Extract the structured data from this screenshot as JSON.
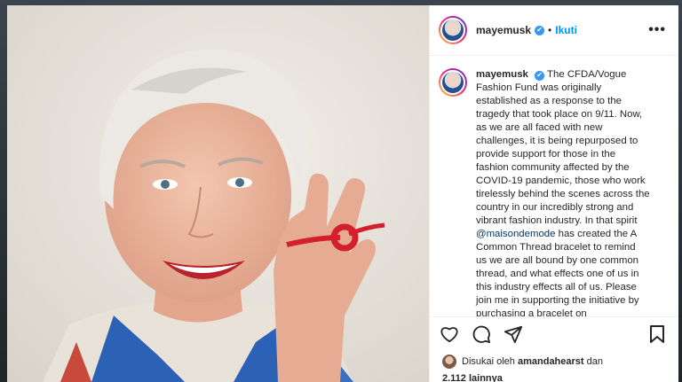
{
  "post": {
    "username": "mayemusk",
    "separator": "•",
    "follow_label": "Ikuti",
    "more_label": "•••",
    "verified_mark": "✔",
    "caption_lines": [
      "The CFDA/Vogue",
      "Fashion Fund was originally",
      "established as a response to the",
      "tragedy that took place on 9/11. Now,",
      "as we are all faced with new",
      "challenges, it is being repurposed to",
      "provide support for those in the",
      "fashion community affected by the",
      "COVID-19 pandemic, those who work",
      "tirelessly behind the scenes across the",
      "country in our incredibly strong and",
      "vibrant fashion industry. In that spirit"
    ],
    "mention": "@maisondemode",
    "caption_after_mention": " has created the A",
    "caption_tail_lines": [
      "Common Thread bracelet to remind",
      "us we are all bound by one common",
      "thread, and what effects one of us in",
      "this industry effects all of us. Please",
      "join me in supporting the initiative by",
      "purchasing a bracelet on"
    ],
    "liked_by_prefix": "Disukai oleh",
    "liked_by_user": "amandahearst",
    "liked_by_suffix": "dan",
    "likes_count_text": "2.112 lainnya"
  },
  "icons": {
    "like": "heart-icon",
    "comment": "comment-icon",
    "share": "paper-plane-icon",
    "save": "bookmark-icon"
  },
  "colors": {
    "follow_blue": "#0095f6",
    "verified_blue": "#3897f0",
    "mention_blue": "#00376b"
  }
}
